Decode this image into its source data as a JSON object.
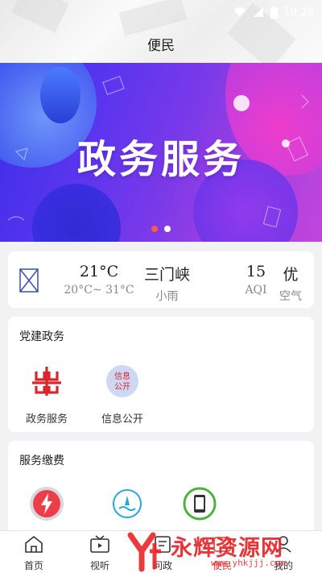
{
  "status": {
    "time": "10:28"
  },
  "header": {
    "title": "便民"
  },
  "banner": {
    "text": "政务服务",
    "slides": 2,
    "active_slide": 0
  },
  "weather": {
    "temp": "21°C",
    "range": "20°C~ 31°C",
    "city": "三门峡",
    "condition": "小雨",
    "aqi_value": "15",
    "aqi_label": "AQI",
    "quality": "优",
    "quality_label": "空气"
  },
  "party": {
    "title": "党建政务",
    "items": [
      {
        "label": "政务服务",
        "icon": "government-logo-icon"
      },
      {
        "label": "信息公开",
        "icon": "info-public-icon",
        "icon_text_1": "信息",
        "icon_text_2": "公开"
      }
    ]
  },
  "fees": {
    "title": "服务缴费",
    "items": [
      {
        "icon": "electricity-icon"
      },
      {
        "icon": "water-icon"
      },
      {
        "icon": "phone-icon"
      }
    ]
  },
  "nav": {
    "items": [
      {
        "label": "首页",
        "icon": "home-icon"
      },
      {
        "label": "视听",
        "icon": "tv-icon"
      },
      {
        "label": "问政",
        "icon": "ask-icon"
      },
      {
        "label": "便民",
        "icon": "service-icon"
      },
      {
        "label": "我的",
        "icon": "profile-icon"
      }
    ],
    "active": 3
  },
  "watermark": {
    "text": "永辉资源网",
    "url": "www.yhkjjj.com"
  },
  "colors": {
    "accent": "#e53935",
    "banner_start": "#3a2ee6",
    "banner_end": "#c046dc"
  }
}
